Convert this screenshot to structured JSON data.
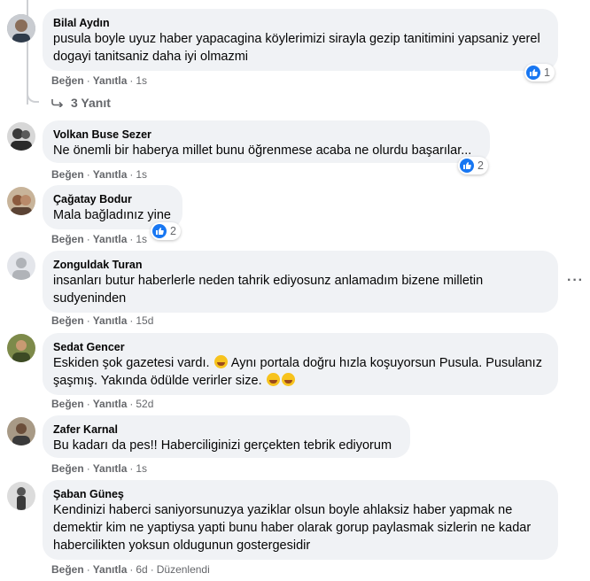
{
  "labels": {
    "like": "Beğen",
    "reply": "Yanıtla",
    "edited": "Düzenlendi"
  },
  "top_cut_text": "Beğen · Yanıtla · 1s",
  "replies_toggle": "3 Yanıt",
  "comments": [
    {
      "author": "Bilal Aydın",
      "text": "pusula boyle uyuz haber yapacagina köylerimizi sirayla gezip tanitimini yapsaniz yerel dogayi tanitsaniz daha iyi olmazmi",
      "time": "1s",
      "reactions": "1",
      "avatar_color": "#8a8f94"
    },
    {
      "author": "Volkan Buse Sezer",
      "text": "Ne önemli bir haberya millet bunu öğrenmese acaba ne olurdu başarılar...",
      "time": "1s",
      "reactions": "2",
      "avatar_color": "#4a4a4a"
    },
    {
      "author": "Çağatay Bodur",
      "text": "Mala bağladınız yine",
      "time": "1s",
      "reactions": "2",
      "avatar_color": "#b07a5a"
    },
    {
      "author": "Zonguldak Turan",
      "text": "insanları butur haberlerle neden tahrik ediyosunz anlamadım bizene milletin sudyeninden",
      "time": "15d",
      "avatar_color": "#d8d8d8"
    },
    {
      "author": "Sedat Gencer",
      "text_before": "Eskiden şok gazetesi vardı.",
      "text_middle": " Aynı portala doğru hızla koşuyorsun Pusula. Pusulanız şaşmış. Yakında ödülde verirler size.",
      "time": "52d",
      "avatar_color": "#5f6b3a"
    },
    {
      "author": "Zafer Karnal",
      "text": "Bu kadarı da pes!! Haberciliginizi gerçekten tebrik ediyorum",
      "time": "1s",
      "avatar_color": "#6b5a48"
    },
    {
      "author": "Şaban Güneş",
      "text": "Kendinizi haberci saniyorsunuzya yaziklar olsun boyle ahlaksiz haber yapmak ne demektir kim ne yaptiysa yapti bunu haber olarak gorup paylasmak sizlerin ne kadar habercilikten yoksun oldugunun gostergesidir",
      "time": "6d",
      "avatar_color": "#7a7a7a"
    }
  ],
  "colors": {
    "accent": "#1877f2",
    "bubble": "#f0f2f5",
    "meta": "#65676b",
    "thread": "#ced0d4"
  }
}
